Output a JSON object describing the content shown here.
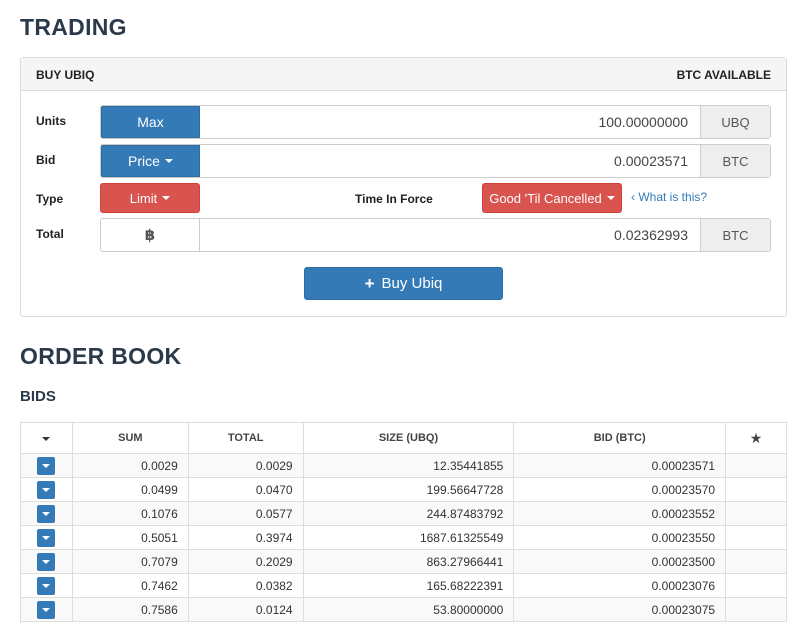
{
  "trading": {
    "title": "TRADING",
    "panel": {
      "left_title": "BUY UBIQ",
      "right_title": "BTC AVAILABLE"
    },
    "units": {
      "label": "Units",
      "button": "Max",
      "value": "100.00000000",
      "unit": "UBQ"
    },
    "bid": {
      "label": "Bid",
      "button": "Price",
      "value": "0.00023571",
      "unit": "BTC"
    },
    "type": {
      "label": "Type",
      "button": "Limit"
    },
    "time_in_force": {
      "label": "Time In Force",
      "button": "Good 'Til Cancelled",
      "help": "What is this?"
    },
    "total": {
      "label": "Total",
      "symbol": "฿",
      "value": "0.02362993",
      "unit": "BTC"
    },
    "submit": {
      "label": "Buy Ubiq",
      "icon": "plus-icon"
    }
  },
  "order_book": {
    "title": "ORDER BOOK",
    "bids_title": "BIDS",
    "columns": [
      "SUM",
      "TOTAL",
      "SIZE (UBQ)",
      "BID (BTC)"
    ],
    "rows": [
      [
        "0.0029",
        "0.0029",
        "12.35441855",
        "0.00023571"
      ],
      [
        "0.0499",
        "0.0470",
        "199.56647728",
        "0.00023570"
      ],
      [
        "0.1076",
        "0.0577",
        "244.87483792",
        "0.00023552"
      ],
      [
        "0.5051",
        "0.3974",
        "1687.61325549",
        "0.00023550"
      ],
      [
        "0.7079",
        "0.2029",
        "863.27966441",
        "0.00023500"
      ],
      [
        "0.7462",
        "0.0382",
        "165.68222391",
        "0.00023076"
      ],
      [
        "0.7586",
        "0.0124",
        "53.80000000",
        "0.00023075"
      ]
    ]
  },
  "colors": {
    "primary": "#337ab7",
    "danger": "#d9534f",
    "heading": "#2b3a4a"
  }
}
